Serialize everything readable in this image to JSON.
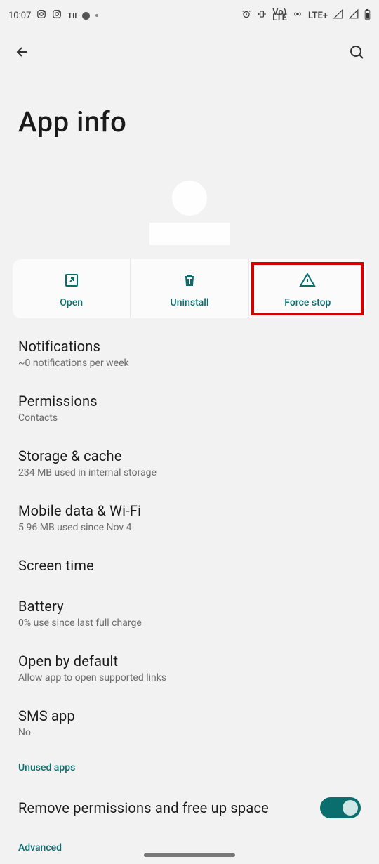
{
  "status": {
    "time": "10:07",
    "left_icons": [
      "instagram1",
      "instagram2",
      "TII"
    ],
    "lte_label": "LTE+",
    "volte_label": "Vo)\nLTE"
  },
  "header": {
    "title": "App info"
  },
  "actions": {
    "open": "Open",
    "uninstall": "Uninstall",
    "force_stop": "Force stop"
  },
  "rows": {
    "notifications": {
      "title": "Notifications",
      "sub": "~0 notifications per week"
    },
    "permissions": {
      "title": "Permissions",
      "sub": "Contacts"
    },
    "storage": {
      "title": "Storage & cache",
      "sub": "234 MB used in internal storage"
    },
    "mobile": {
      "title": "Mobile data & Wi-Fi",
      "sub": "5.96 MB used since Nov 4"
    },
    "screen_time": {
      "title": "Screen time"
    },
    "battery": {
      "title": "Battery",
      "sub": "0% use since last full charge"
    },
    "open_default": {
      "title": "Open by default",
      "sub": "Allow app to open supported links"
    },
    "sms": {
      "title": "SMS app",
      "sub": "No"
    }
  },
  "sections": {
    "unused": "Unused apps",
    "remove_perm": "Remove permissions and free up space",
    "advanced": "Advanced"
  },
  "accent": "#0b6e6e"
}
